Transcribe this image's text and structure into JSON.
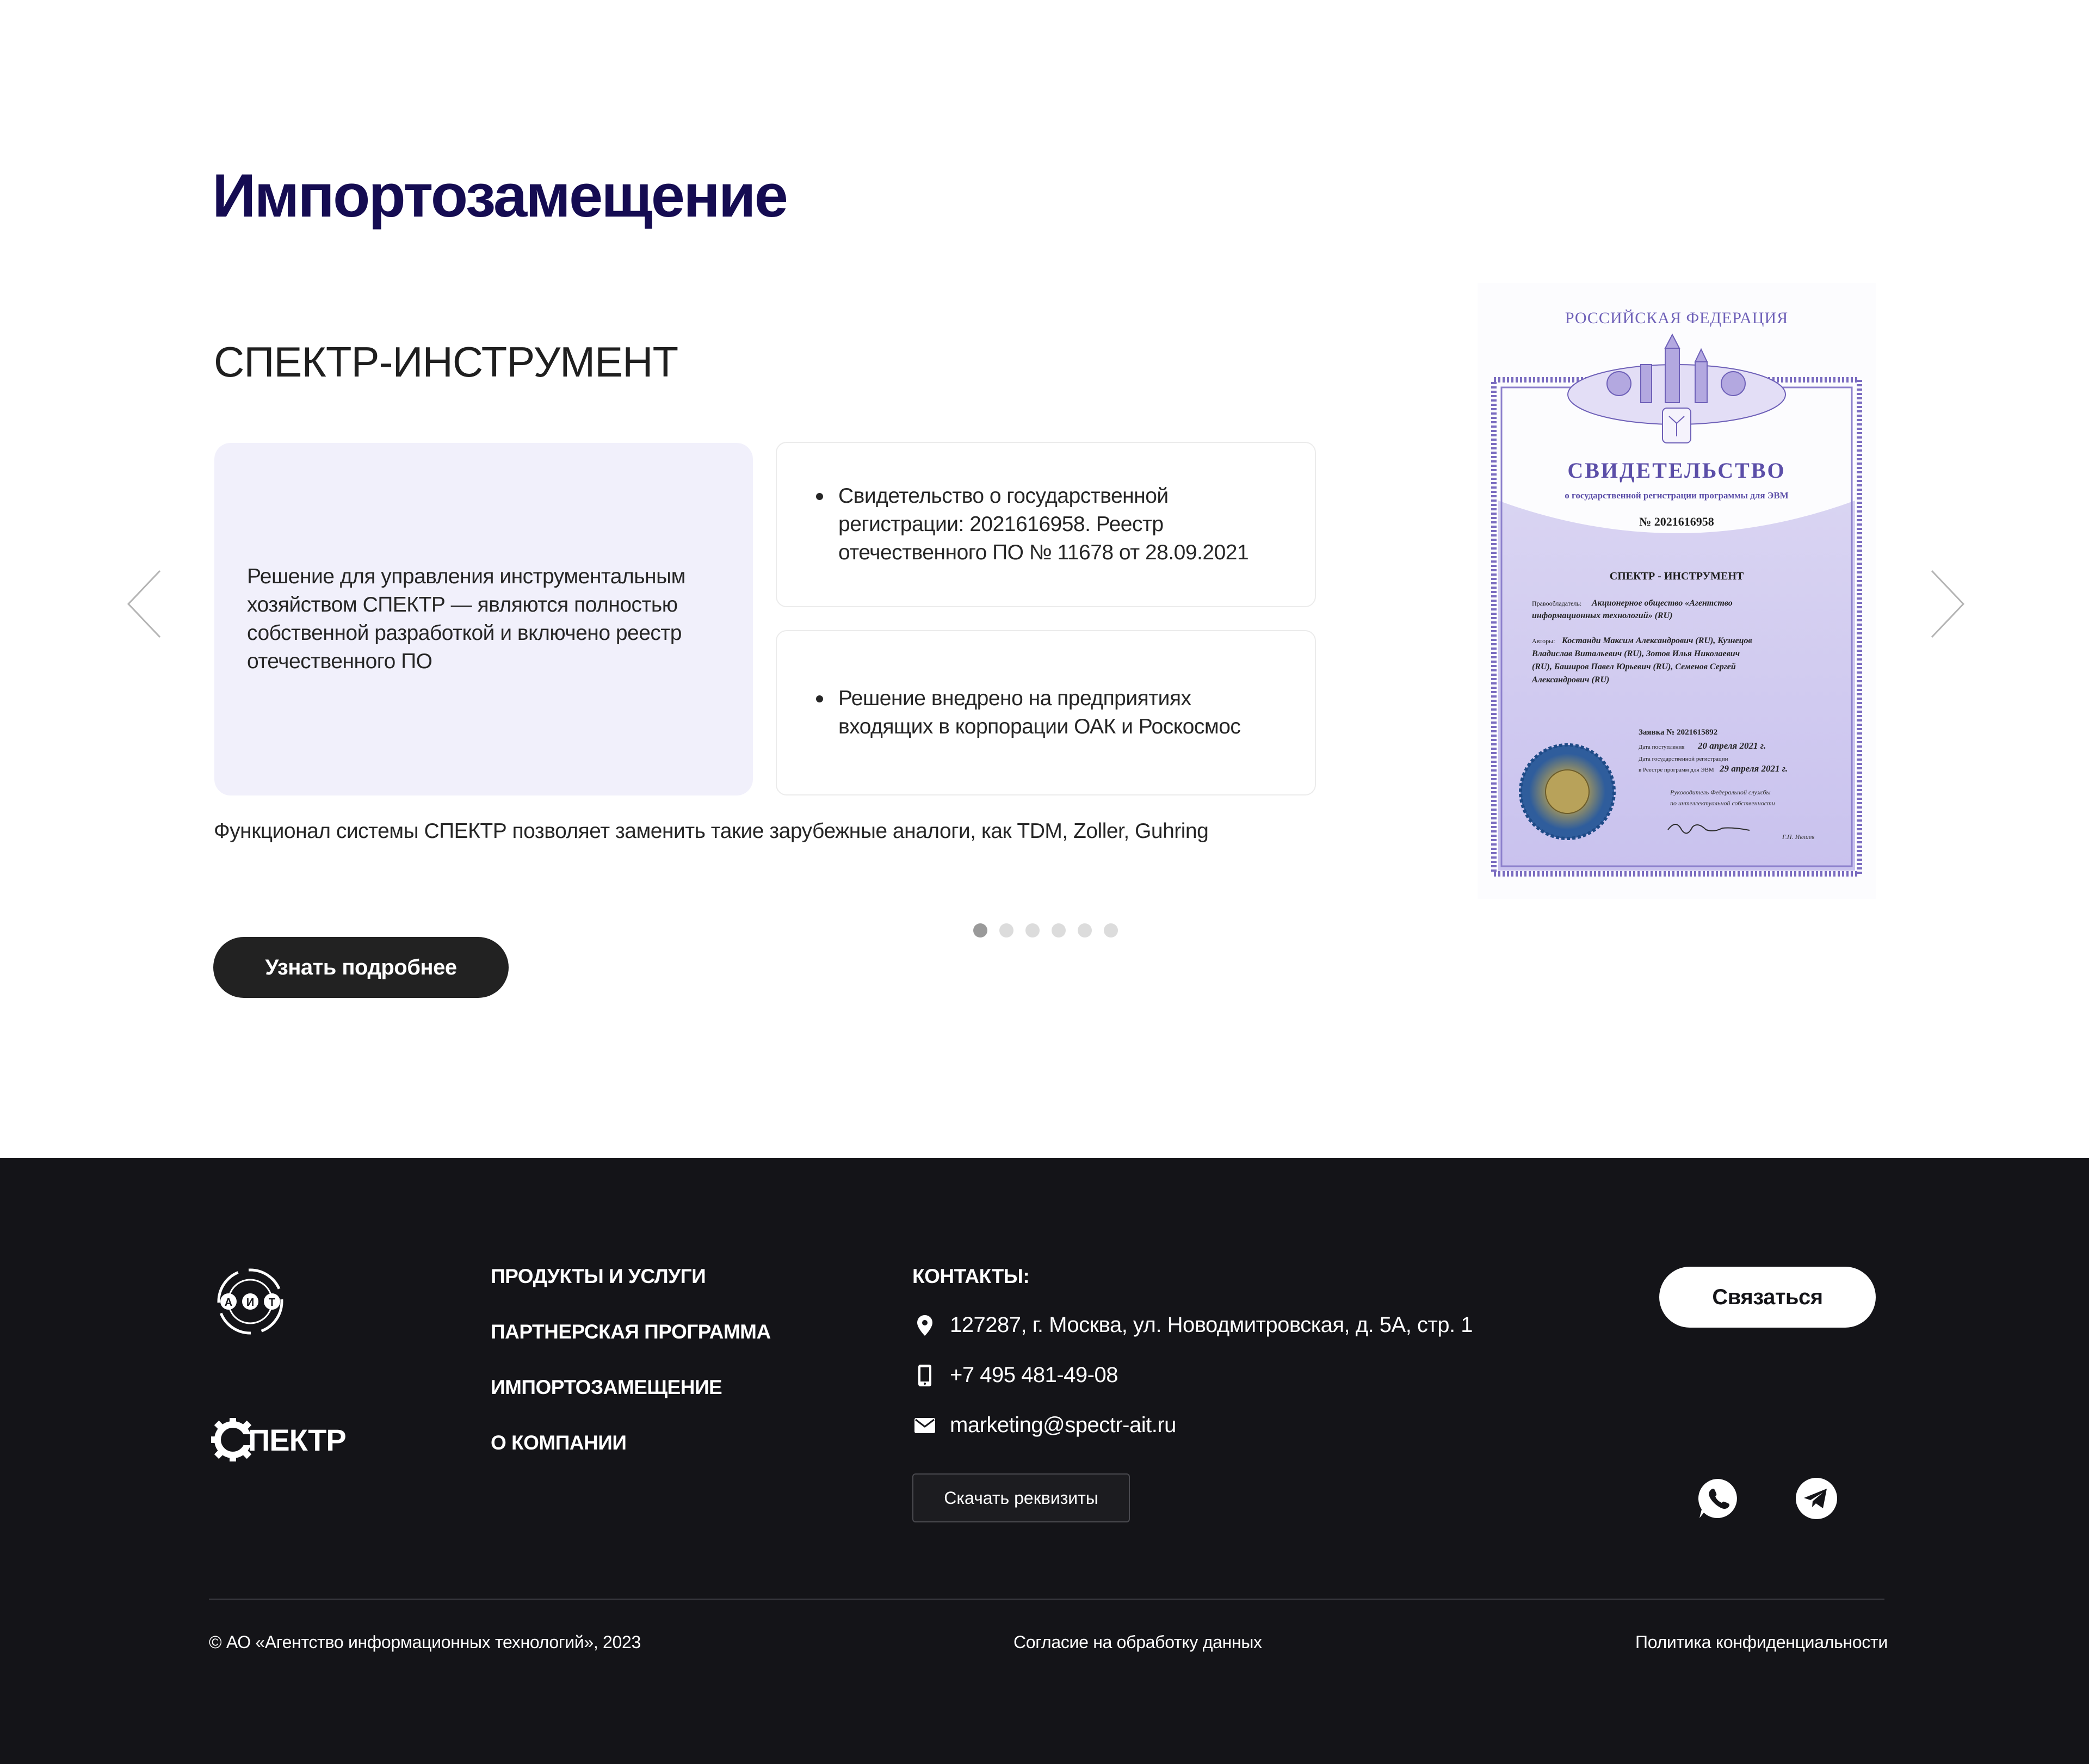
{
  "main": {
    "title": "Импортозамещение",
    "product_title": "СПЕКТР-ИНСТРУМЕНТ",
    "card_main_text": "Решение для управления инструментальным хозяйством СПЕКТР — являются полностью собственной разработкой и включено реестр отечественного ПО",
    "card_items": [
      "Свидетельство о государственной регистрации: 2021616958. Реестр отечественного ПО № 11678 от 28.09.2021",
      "Решение внедрено на предприятиях входящих в корпорации ОАК и Роскосмос"
    ],
    "functional_text": "Функционал системы СПЕКТР позволяет заменить такие зарубежные аналоги, как TDM, Zoller, Guhring",
    "more_button": "Узнать подробнее",
    "slider": {
      "total": 6,
      "active": 1
    },
    "icons": {
      "prev": "chevron-left-icon",
      "next": "chevron-right-icon"
    }
  },
  "certificate": {
    "country": "РОССИЙСКАЯ ФЕДЕРАЦИЯ",
    "title": "СВИДЕТЕЛЬСТВО",
    "subtitle": "о государственной регистрации программы для ЭВМ",
    "number": "№ 2021616958",
    "program": "СПЕКТР - ИНСТРУМЕНТ",
    "holder_label": "Правообладатель:",
    "holder_line1": "Акционерное общество «Агентство",
    "holder_line2": "информационных технологий» (RU)",
    "authors_label": "Авторы:",
    "authors_line1": "Костанди Максим Александрович (RU), Кузнецов",
    "authors_line2": "Владислав Витальевич (RU), Зотов Илья Николаевич",
    "authors_line3": "(RU), Баширов Павел Юрьевич (RU), Семенов Сергей",
    "authors_line4": "Александрович (RU)",
    "application": "Заявка № 2021615892",
    "received_label": "Дата поступления",
    "received_date": "20 апреля 2021 г.",
    "reg_label1": "Дата государственной регистрации",
    "reg_label2": "в Реестре программ для ЭВМ",
    "reg_date": "29 апреля 2021 г.",
    "head_line1": "Руководитель Федеральной службы",
    "head_line2": "по интеллектуальной собственности",
    "signer": "Г.П. Ивлиев",
    "accent_color": "#5b4ea8"
  },
  "footer": {
    "logo_ait_letters": [
      "А",
      "И",
      "Т"
    ],
    "logo_spektr": "ПЕКТР",
    "nav": [
      "ПРОДУКТЫ И УСЛУГИ",
      "ПАРТНЕРСКАЯ ПРОГРАММА",
      "ИМПОРТОЗАМЕЩЕНИЕ",
      "О КОМПАНИИ"
    ],
    "contacts_title": "КОНТАКТЫ:",
    "address": "127287, г. Москва, ул. Новодмитровская, д. 5А, стр. 1",
    "phone": "+7 495 481-49-08",
    "email": "marketing@spectr-ait.ru",
    "requisites_button": "Скачать реквизиты",
    "contact_button": "Связаться",
    "social": [
      "whatsapp-icon",
      "telegram-icon"
    ],
    "copyright": "© АО «Агентство информационных технологий», 2023",
    "consent": "Согласие на обработку данных",
    "policy": "Политика конфиденциальности",
    "background_color": "#141418"
  }
}
